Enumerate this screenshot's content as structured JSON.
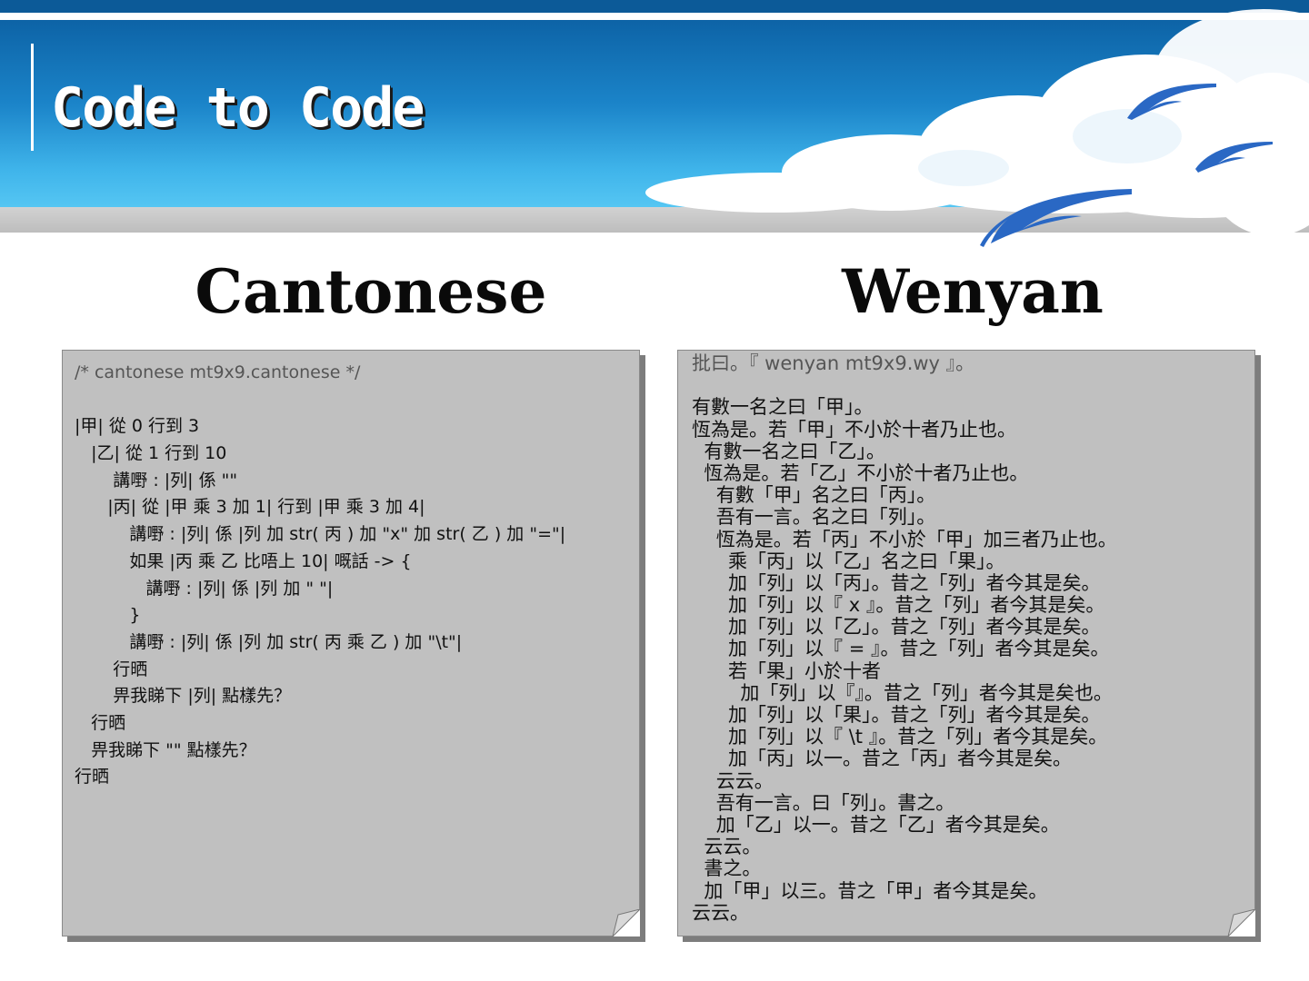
{
  "slide": {
    "title": "Code to Code"
  },
  "columns": {
    "left_heading": "Cantonese",
    "right_heading": "Wenyan"
  },
  "cantonese_code": [
    "/* cantonese mt9x9.cantonese */",
    "",
    "|甲| 從 0 行到 3",
    "   |乙| 從 1 行到 10",
    "       講嘢 : |列| 係 \"\"",
    "      |丙| 從 |甲 乘 3 加 1| 行到 |甲 乘 3 加 4|",
    "          講嘢 : |列| 係 |列 加 str( 丙 ) 加 \"x\" 加 str( 乙 ) 加 \"=\"|",
    "          如果 |丙 乘 乙 比唔上 10| 嘅話 -> {",
    "             講嘢 : |列| 係 |列 加 \" \"|",
    "          }",
    "          講嘢 : |列| 係 |列 加 str( 丙 乘 乙 ) 加 \"\\t\"|",
    "       行晒",
    "       畀我睇下 |列| 點樣先？",
    "   行晒",
    "   畀我睇下 \"\" 點樣先？",
    "行晒"
  ],
  "wenyan_code": [
    "批曰。『 wenyan mt9x9.wy 』。",
    "",
    "有數一名之曰「甲」。",
    "恆為是。若「甲」不小於十者乃止也。",
    "  有數一名之曰「乙」。",
    "  恆為是。若「乙」不小於十者乃止也。",
    "    有數「甲」名之曰「丙」。",
    "    吾有一言。名之曰「列」。",
    "    恆為是。若「丙」不小於「甲」加三者乃止也。",
    "      乘「丙」以「乙」名之曰「果」。",
    "      加「列」以「丙」。昔之「列」者今其是矣。",
    "      加「列」以『 x 』。昔之「列」者今其是矣。",
    "      加「列」以「乙」。昔之「列」者今其是矣。",
    "      加「列」以『 = 』。昔之「列」者今其是矣。",
    "      若「果」小於十者",
    "        加「列」以『』。昔之「列」者今其是矣也。",
    "      加「列」以「果」。昔之「列」者今其是矣。",
    "      加「列」以『 \\t 』。昔之「列」者今其是矣。",
    "      加「丙」以一。昔之「丙」者今其是矣。",
    "    云云。",
    "    吾有一言。曰「列」。書之。",
    "    加「乙」以一。昔之「乙」者今其是矣。",
    "  云云。",
    "  書之。",
    "  加「甲」以三。昔之「甲」者今其是矣。",
    "云云。"
  ],
  "colors": {
    "banner_top": "#0c5a98",
    "sky_light": "#55c6f3",
    "panel_fill": "#c0c0c0",
    "panel_shadow": "#7d7d7d",
    "bird": "#2a68c4"
  }
}
